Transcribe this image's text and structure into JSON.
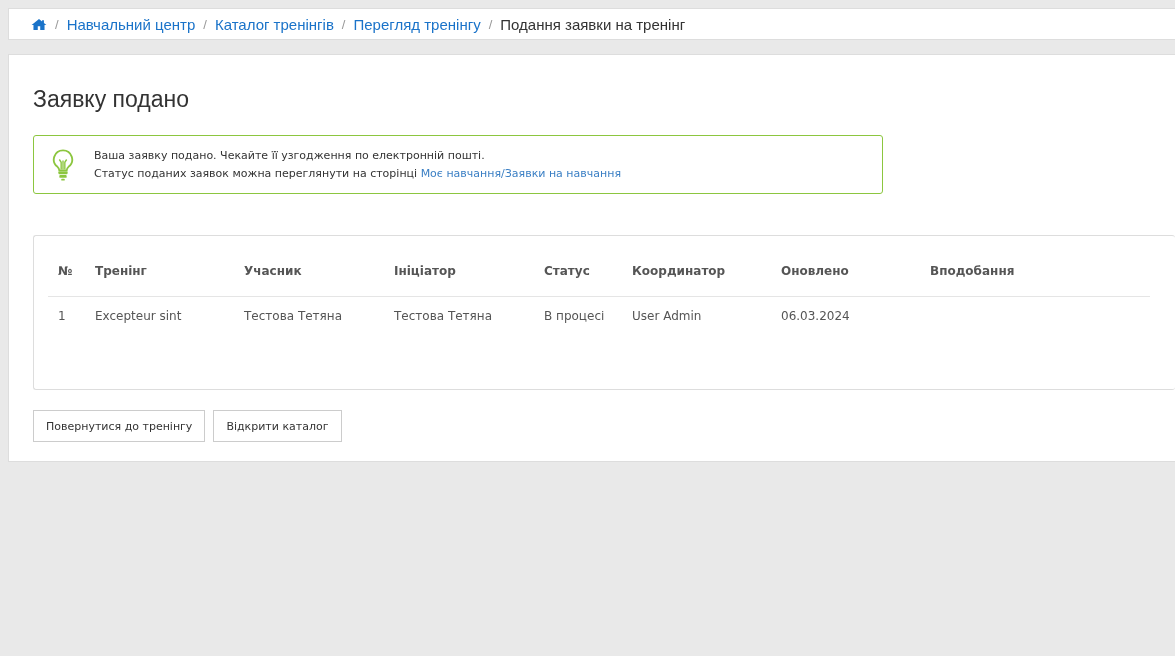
{
  "breadcrumb": [
    {
      "separator": "/",
      "label": "Навчальний центр",
      "link": true
    },
    {
      "separator": "/",
      "label": "Каталог тренінгів",
      "link": true
    },
    {
      "separator": "/",
      "label": "Перегляд тренінгу",
      "link": true
    },
    {
      "separator": "/",
      "label": "Подання заявки на тренінг",
      "link": false
    }
  ],
  "title": "Заявку подано",
  "alert": {
    "line_1": "Ваша заявку подано. Чекайте її узгодження по електронній пошті.",
    "line_2": "Статус поданих заявок можна переглянути на сторінці",
    "link": "Моє навчання/Заявки на навчання"
  },
  "table": {
    "columns": [
      "№",
      "Тренінг",
      "Учасник",
      "Ініціатор",
      "Статус",
      "Координатор",
      "Оновлено",
      "Вподобання"
    ],
    "rows": [
      [
        "1",
        "Excepteur sint",
        "Тестова Тетяна",
        "Тестова Тетяна",
        "В процесі",
        "User Admin",
        "06.03.2024",
        ""
      ]
    ]
  },
  "buttons": [
    "Повернутися до тренінгу",
    "Відкрити каталог"
  ]
}
